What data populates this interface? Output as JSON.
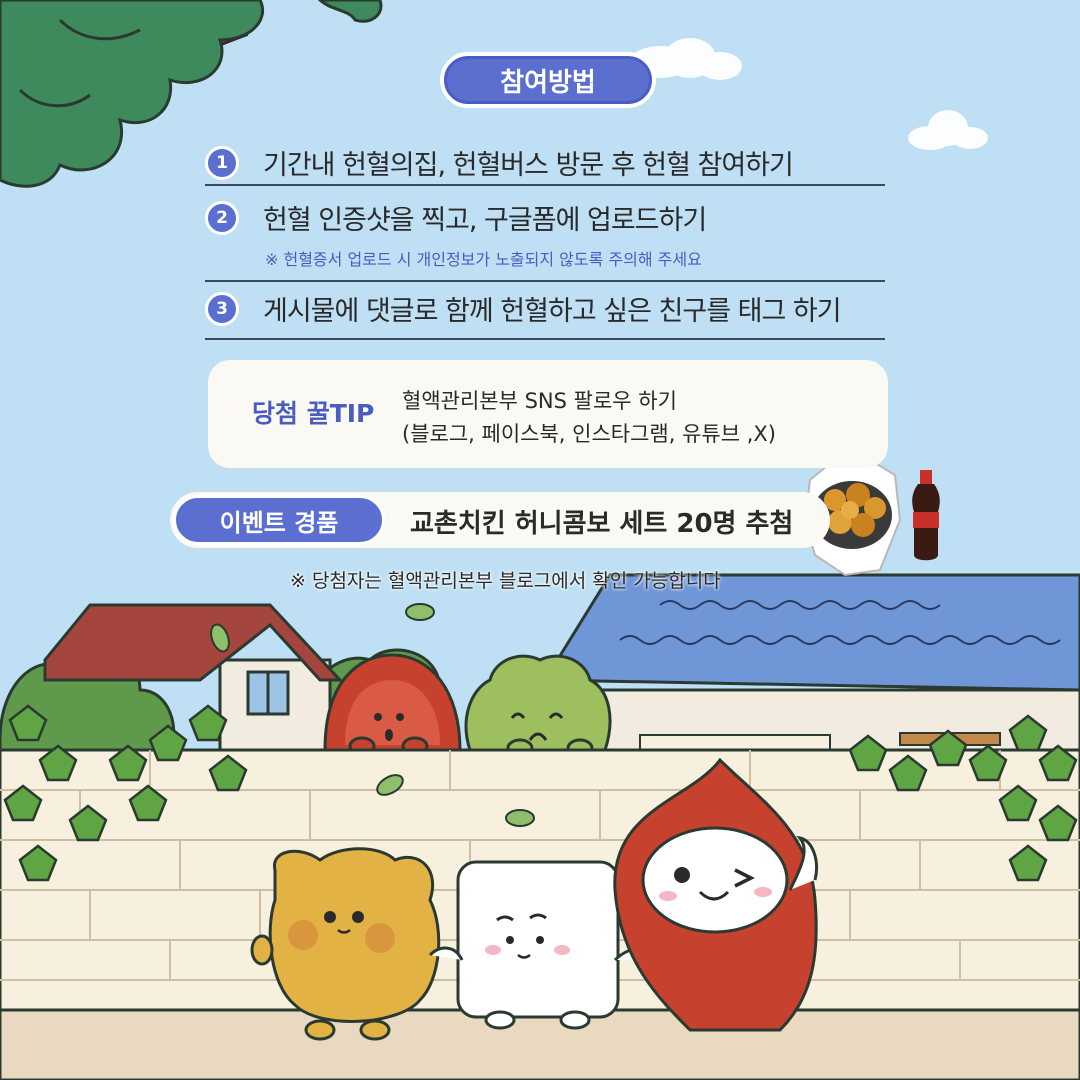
{
  "section_title": "참여방법",
  "steps": [
    {
      "num": "1",
      "text": "기간내 헌혈의집, 헌혈버스 방문 후 헌혈 참여하기"
    },
    {
      "num": "2",
      "text": "헌혈 인증샷을 찍고, 구글폼에 업로드하기"
    },
    {
      "num": "3",
      "text": "게시물에 댓글로 함께 헌혈하고 싶은 친구를 태그 하기"
    }
  ],
  "step2_note": "※ 헌혈증서 업로드 시 개인정보가 노출되지 않도록 주의해 주세요",
  "tip": {
    "label": "당첨 꿀TIP",
    "line1": "혈액관리본부 SNS 팔로우 하기",
    "line2": "(블로그, 페이스북, 인스타그램, 유튜브 ,X)"
  },
  "prize": {
    "label": "이벤트 경품",
    "text": "교촌치킨 허니콤보 세트 20명 추첨"
  },
  "winner_note": "※ 당첨자는 혈액관리본부 블로그에서 확인 가능합니다",
  "colors": {
    "sky": "#bfe0f4",
    "accent": "#5a6fd0",
    "roof_blue": "#6f97d8",
    "roof_red": "#a5463e",
    "wall": "#f7f0df",
    "ground": "#e8d9c0",
    "mascot_red": "#c7412f",
    "mascot_yellow": "#e3b244"
  },
  "icons": [
    "tree-branch-icon",
    "cloud-icon",
    "chicken-basket-icon",
    "cola-bottle-icon",
    "ivy-leaf-icon",
    "house-icon",
    "blood-drop-mascot-icon",
    "plasma-mascot-icon",
    "platelet-mascot-icon",
    "red-cell-mascot-icon",
    "green-cell-mascot-icon"
  ]
}
